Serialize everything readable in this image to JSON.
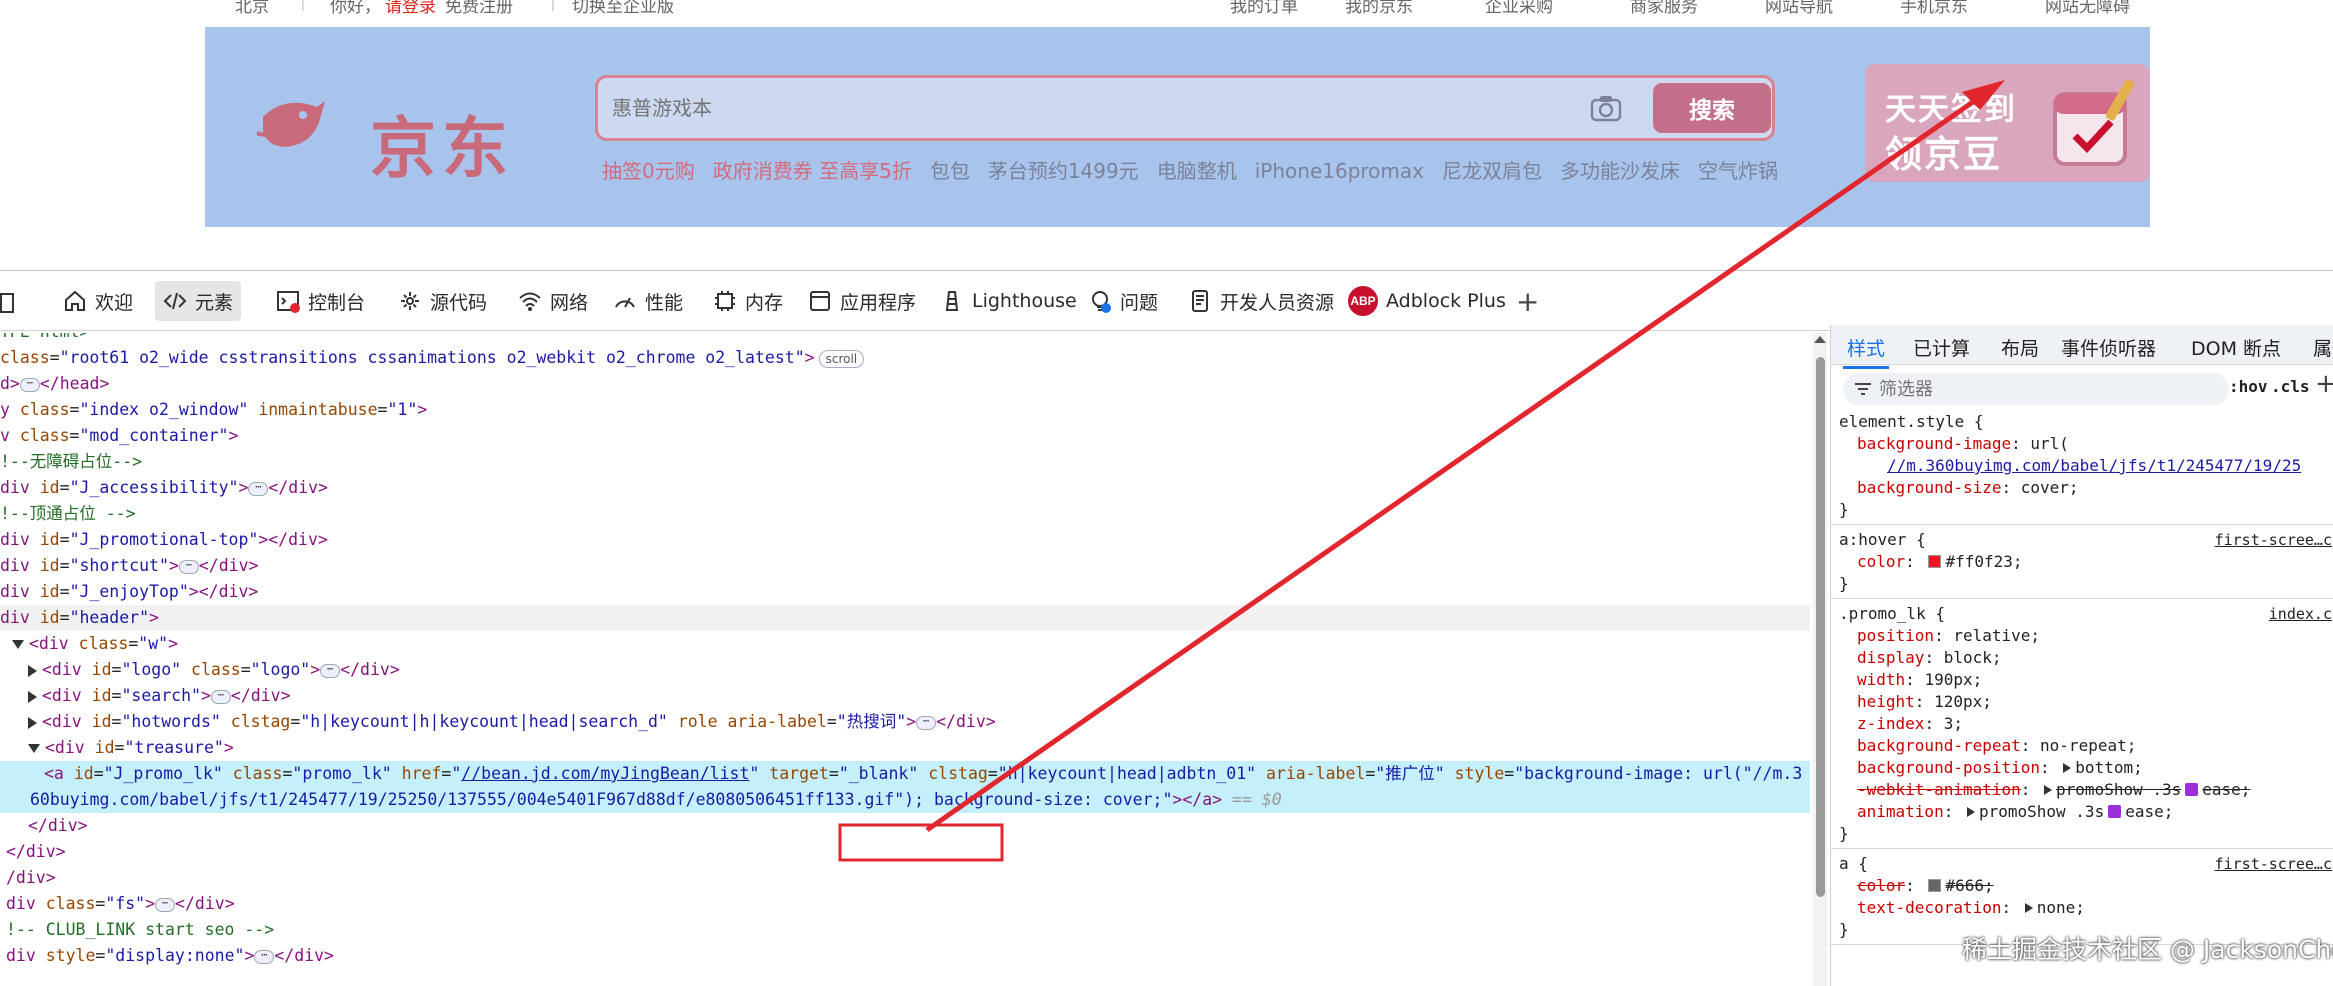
{
  "page_top": {
    "topbar": [
      {
        "text": "北京",
        "red": false
      },
      {
        "text": "|",
        "red": false,
        "sep": true
      },
      {
        "text": "你好，",
        "red": false
      },
      {
        "text": "请登录",
        "red": true
      },
      {
        "text": "免费注册",
        "red": false
      },
      {
        "text": "|",
        "red": false,
        "sep": true
      },
      {
        "text": "切换至企业版",
        "red": false
      },
      {
        "text": "我的订单",
        "red": false
      },
      {
        "text": "我的京东",
        "red": false
      },
      {
        "text": "企业采购",
        "red": false
      },
      {
        "text": "商家服务",
        "red": false
      },
      {
        "text": "网站导航",
        "red": false
      },
      {
        "text": "手机京东",
        "red": false
      },
      {
        "text": "网站无障碍",
        "red": false
      }
    ],
    "logo_text": "京东",
    "search_placeholder": "惠普游戏本",
    "search_button": "搜索",
    "hotwords": [
      {
        "text": "抽签0元购",
        "hot": true
      },
      {
        "text": "政府消费券 至高享5折",
        "hot": true
      },
      {
        "text": "包包",
        "hot": false
      },
      {
        "text": "茅台预约1499元",
        "hot": false
      },
      {
        "text": "电脑整机",
        "hot": false
      },
      {
        "text": "iPhone16promax",
        "hot": false
      },
      {
        "text": "尼龙双肩包",
        "hot": false
      },
      {
        "text": "多功能沙发床",
        "hot": false
      },
      {
        "text": "空气炸锅",
        "hot": false
      }
    ],
    "treasure_line1": "天天签到",
    "treasure_line2": "领京豆"
  },
  "devtools": {
    "tabs": [
      {
        "label": "欢迎",
        "icon": "home-icon",
        "active": false
      },
      {
        "label": "元素",
        "icon": "code-icon",
        "active": true
      },
      {
        "label": "控制台",
        "icon": "console-icon",
        "active": false
      },
      {
        "label": "源代码",
        "icon": "sources-icon",
        "active": false
      },
      {
        "label": "网络",
        "icon": "wifi-icon",
        "active": false
      },
      {
        "label": "性能",
        "icon": "performance-icon",
        "active": false
      },
      {
        "label": "内存",
        "icon": "memory-icon",
        "active": false
      },
      {
        "label": "应用程序",
        "icon": "application-icon",
        "active": false
      },
      {
        "label": "Lighthouse",
        "icon": "lighthouse-icon",
        "active": false
      },
      {
        "label": "问题",
        "icon": "issues-icon",
        "active": false
      },
      {
        "label": "开发人员资源",
        "icon": "document-icon",
        "active": false
      },
      {
        "label": "Adblock Plus",
        "icon": "adblock-icon",
        "active": false
      }
    ],
    "abp_badge": "ABP",
    "add_tab": "+",
    "tree": [
      {
        "parts": [
          [
            "cmt",
            "YPE html>"
          ]
        ]
      },
      {
        "parts": [
          [
            "attr",
            "class"
          ],
          [
            "txt",
            "="
          ],
          [
            "val",
            "\"root61 o2_wide csstransitions cssanimations o2_webkit o2_chrome o2_latest\""
          ],
          [
            "tag",
            ">"
          ],
          [
            "pill",
            "scroll"
          ]
        ]
      },
      {
        "parts": [
          [
            "tag",
            "d>"
          ],
          [
            "dots",
            "⋯"
          ],
          [
            "tag",
            "</head>"
          ]
        ]
      },
      {
        "parts": [
          [
            "tag",
            "y "
          ],
          [
            "attr",
            "class"
          ],
          [
            "txt",
            "="
          ],
          [
            "val",
            "\"index o2_window\""
          ],
          [
            "txt",
            " "
          ],
          [
            "attr",
            "inmaintabuse"
          ],
          [
            "txt",
            "="
          ],
          [
            "val",
            "\"1\""
          ],
          [
            "tag",
            ">"
          ]
        ]
      },
      {
        "parts": [
          [
            "tag",
            "v "
          ],
          [
            "attr",
            "class"
          ],
          [
            "txt",
            "="
          ],
          [
            "val",
            "\"mod_container\""
          ],
          [
            "tag",
            ">"
          ]
        ]
      },
      {
        "parts": [
          [
            "cmt",
            "!--无障碍占位-->"
          ]
        ]
      },
      {
        "parts": [
          [
            "tag",
            "div "
          ],
          [
            "attr",
            "id"
          ],
          [
            "txt",
            "="
          ],
          [
            "val",
            "\"J_accessibility\""
          ],
          [
            "tag",
            ">"
          ],
          [
            "dots",
            "⋯"
          ],
          [
            "tag",
            "</div>"
          ]
        ]
      },
      {
        "parts": [
          [
            "cmt",
            "!--顶通占位 -->"
          ]
        ]
      },
      {
        "parts": [
          [
            "tag",
            "div "
          ],
          [
            "attr",
            "id"
          ],
          [
            "txt",
            "="
          ],
          [
            "val",
            "\"J_promotional-top\""
          ],
          [
            "tag",
            "></div>"
          ]
        ]
      },
      {
        "parts": [
          [
            "tag",
            "div "
          ],
          [
            "attr",
            "id"
          ],
          [
            "txt",
            "="
          ],
          [
            "val",
            "\"shortcut\""
          ],
          [
            "tag",
            ">"
          ],
          [
            "dots",
            "⋯"
          ],
          [
            "tag",
            "</div>"
          ]
        ]
      },
      {
        "parts": [
          [
            "tag",
            "div "
          ],
          [
            "attr",
            "id"
          ],
          [
            "txt",
            "="
          ],
          [
            "val",
            "\"J_enjoyTop\""
          ],
          [
            "tag",
            "></div>"
          ]
        ]
      },
      {
        "parts": [
          [
            "tag",
            "div "
          ],
          [
            "attr",
            "id"
          ],
          [
            "txt",
            "="
          ],
          [
            "val",
            "\"header\""
          ],
          [
            "tag",
            ">"
          ]
        ],
        "state": "hover"
      },
      {
        "parts": [
          [
            "tri-open",
            ""
          ],
          [
            "tag",
            "<div "
          ],
          [
            "attr",
            "class"
          ],
          [
            "txt",
            "="
          ],
          [
            "val",
            "\"w\""
          ],
          [
            "tag",
            ">"
          ]
        ]
      },
      {
        "parts": [
          [
            "tri",
            ""
          ],
          [
            "tag",
            "<div "
          ],
          [
            "attr",
            "id"
          ],
          [
            "txt",
            "="
          ],
          [
            "val",
            "\"logo\""
          ],
          [
            "txt",
            " "
          ],
          [
            "attr",
            "class"
          ],
          [
            "txt",
            "="
          ],
          [
            "val",
            "\"logo\""
          ],
          [
            "tag",
            ">"
          ],
          [
            "dots",
            "⋯"
          ],
          [
            "tag",
            "</div>"
          ]
        ],
        "indent": 1
      },
      {
        "parts": [
          [
            "tri",
            ""
          ],
          [
            "tag",
            "<div "
          ],
          [
            "attr",
            "id"
          ],
          [
            "txt",
            "="
          ],
          [
            "val",
            "\"search\""
          ],
          [
            "tag",
            ">"
          ],
          [
            "dots",
            "⋯"
          ],
          [
            "tag",
            "</div>"
          ]
        ],
        "indent": 1
      },
      {
        "parts": [
          [
            "tri",
            ""
          ],
          [
            "tag",
            "<div "
          ],
          [
            "attr",
            "id"
          ],
          [
            "txt",
            "="
          ],
          [
            "val",
            "\"hotwords\""
          ],
          [
            "txt",
            " "
          ],
          [
            "attr",
            "clstag"
          ],
          [
            "txt",
            "="
          ],
          [
            "val",
            "\"h|keycount|h|keycount|head|search_d\""
          ],
          [
            "txt",
            " "
          ],
          [
            "attr",
            "role"
          ],
          [
            "txt",
            " "
          ],
          [
            "attr",
            "aria-label"
          ],
          [
            "txt",
            "="
          ],
          [
            "val",
            "\"热搜词\""
          ],
          [
            "tag",
            ">"
          ],
          [
            "dots",
            "⋯"
          ],
          [
            "tag",
            "</div>"
          ]
        ],
        "indent": 1
      },
      {
        "parts": [
          [
            "tri-open",
            ""
          ],
          [
            "tag",
            "<div "
          ],
          [
            "attr",
            "id"
          ],
          [
            "txt",
            "="
          ],
          [
            "val",
            "\"treasure\""
          ],
          [
            "tag",
            ">"
          ]
        ],
        "indent": 1
      },
      {
        "parts": [
          [
            "tag",
            "<a "
          ],
          [
            "attr",
            "id"
          ],
          [
            "txt",
            "="
          ],
          [
            "val",
            "\"J_promo_lk\""
          ],
          [
            "txt",
            " "
          ],
          [
            "attr",
            "class"
          ],
          [
            "txt",
            "="
          ],
          [
            "val",
            "\"promo_lk\""
          ],
          [
            "txt",
            " "
          ],
          [
            "attr",
            "href"
          ],
          [
            "txt",
            "="
          ],
          [
            "val",
            "\""
          ],
          [
            "link",
            "//bean.jd.com/myJingBean/list"
          ],
          [
            "val",
            "\""
          ],
          [
            "txt",
            " "
          ],
          [
            "attr",
            "target"
          ],
          [
            "txt",
            "="
          ],
          [
            "val",
            "\"_blank\""
          ],
          [
            "txt",
            " "
          ],
          [
            "attr",
            "clstag"
          ],
          [
            "txt",
            "="
          ],
          [
            "val",
            "\"h|keycount|head|adbtn_01\""
          ],
          [
            "txt",
            " "
          ],
          [
            "attr",
            "aria-label"
          ],
          [
            "txt",
            "="
          ],
          [
            "val",
            "\"推广位\""
          ],
          [
            "txt",
            " "
          ],
          [
            "attr",
            "style"
          ],
          [
            "txt",
            "="
          ],
          [
            "val",
            "\"background-image: url(\"//m.3"
          ]
        ],
        "state": "selected",
        "indent": 2
      },
      {
        "parts": [
          [
            "val",
            "60buyimg.com/babel/jfs/t1/245477/19/25250/137555/004e5401F967d88df/e8080506451ff133.gif\"); background-size: cover;\""
          ],
          [
            "tag",
            "></a>"
          ],
          [
            "eq0",
            " == $0"
          ]
        ],
        "state": "selected",
        "indent": 0
      },
      {
        "parts": [
          [
            "tag",
            "</div>"
          ]
        ],
        "indent": 1
      },
      {
        "parts": [
          [
            "tag",
            "</div>"
          ]
        ],
        "indent": 0
      },
      {
        "parts": [
          [
            "tag",
            "/div>"
          ]
        ]
      },
      {
        "parts": [
          [
            "tag",
            "div "
          ],
          [
            "attr",
            "class"
          ],
          [
            "txt",
            "="
          ],
          [
            "val",
            "\"fs\""
          ],
          [
            "tag",
            ">"
          ],
          [
            "dots",
            "⋯"
          ],
          [
            "tag",
            "</div>"
          ]
        ]
      },
      {
        "parts": [
          [
            "cmt",
            "!-- CLUB_LINK start seo  -->"
          ]
        ]
      },
      {
        "parts": [
          [
            "tag",
            "div "
          ],
          [
            "attr",
            "style"
          ],
          [
            "txt",
            "="
          ],
          [
            "val",
            "\"display:none\""
          ],
          [
            "tag",
            ">"
          ],
          [
            "dots",
            "⋯"
          ],
          [
            "tag",
            "</div>"
          ]
        ]
      }
    ],
    "styles": {
      "tabs": [
        "样式",
        "已计算",
        "布局",
        "事件侦听器",
        "DOM 断点",
        "属性"
      ],
      "filter_placeholder": "筛选器",
      "hov": ":hov",
      "cls": ".cls",
      "plus": "+",
      "rules": [
        {
          "selector": "element.style {",
          "source": "",
          "props": [
            {
              "name": "background-image",
              "value": "url(",
              "line2": "//m.360buyimg.com/babel/jfs/t1/245477/19/25"
            },
            {
              "name": "background-size",
              "value": "cover;"
            }
          ]
        },
        {
          "selector": "a:hover {",
          "source": "first-scree…c",
          "props": [
            {
              "name": "color",
              "value": "#ff0f23;",
              "swatch": "#ff0f23"
            }
          ]
        },
        {
          "selector": ".promo_lk {",
          "source": "index.c",
          "props": [
            {
              "name": "position",
              "value": "relative;"
            },
            {
              "name": "display",
              "value": "block;"
            },
            {
              "name": "width",
              "value": "190px;"
            },
            {
              "name": "height",
              "value": "120px;"
            },
            {
              "name": "z-index",
              "value": "3;"
            },
            {
              "name": "background-repeat",
              "value": "no-repeat;"
            },
            {
              "name": "background-position",
              "value": "bottom;",
              "tri": true
            },
            {
              "name": "-webkit-animation",
              "value": "promoShow .3s",
              "tri": true,
              "ease": "ease;",
              "strike": true
            },
            {
              "name": "animation",
              "value": "promoShow .3s",
              "tri": true,
              "ease": "ease;"
            }
          ]
        },
        {
          "selector": "a {",
          "source": "first-scree…c",
          "props": [
            {
              "name": "color",
              "value": "#666;",
              "swatch": "#666666",
              "strike": true
            },
            {
              "name": "text-decoration",
              "value": "none;",
              "tri": true
            }
          ]
        }
      ]
    }
  },
  "watermark": "稀土掘金技术社区 @ JacksonChen"
}
